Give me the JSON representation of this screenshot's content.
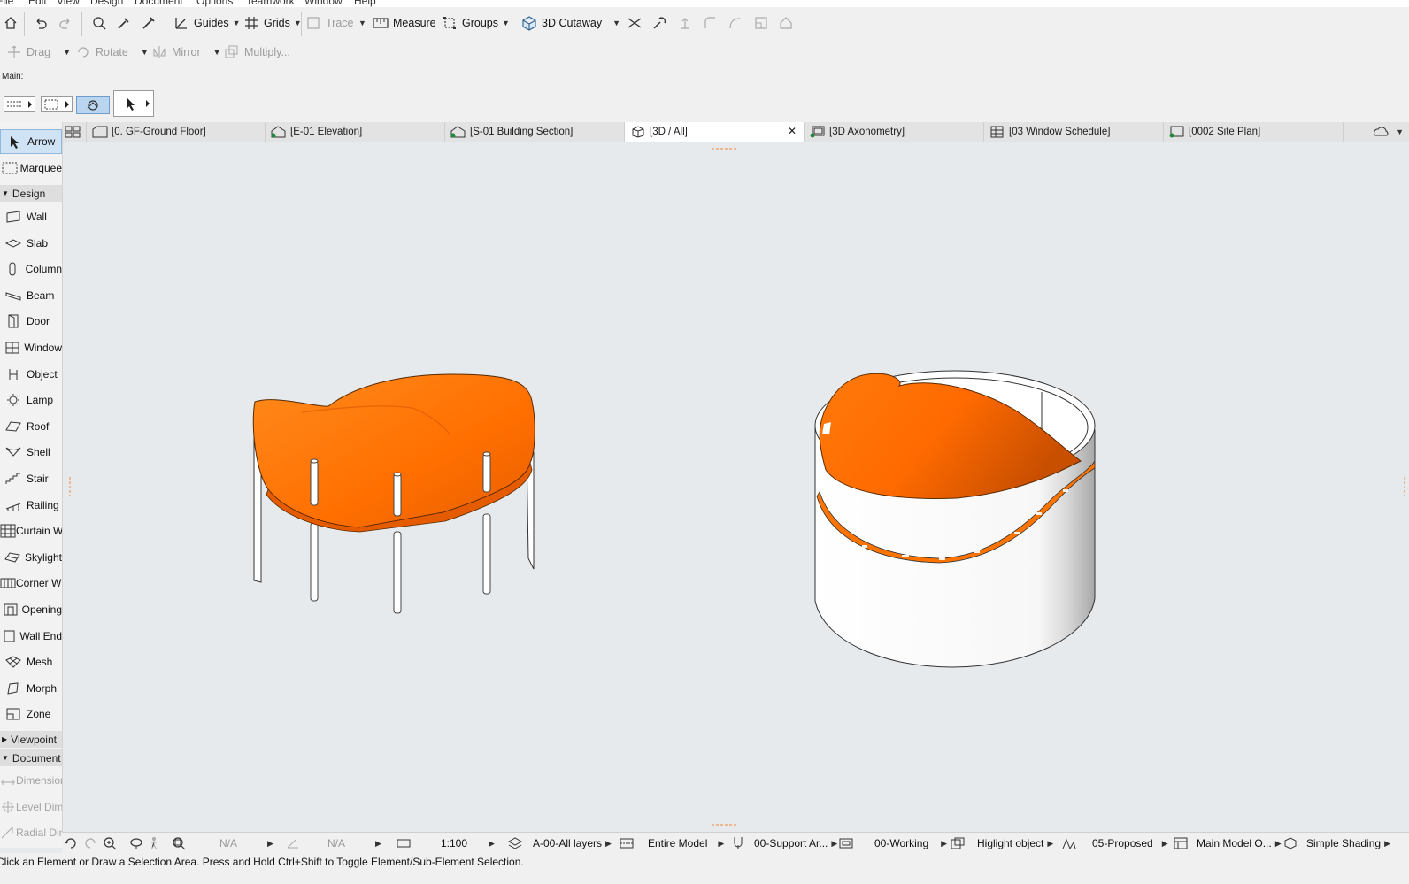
{
  "menu": [
    "File",
    "Edit",
    "View",
    "Design",
    "Document",
    "Options",
    "Teamwork",
    "Window",
    "Help"
  ],
  "toolbar1": {
    "guides": "Guides",
    "grids": "Grids",
    "trace": "Trace",
    "measure": "Measure",
    "groups": "Groups",
    "cutaway": "3D Cutaway"
  },
  "toolbar2": {
    "drag": "Drag",
    "rotate": "Rotate",
    "mirror": "Mirror",
    "multiply": "Multiply..."
  },
  "main_label": "Main:",
  "tabs": [
    {
      "label": "[0. GF-Ground Floor]"
    },
    {
      "label": "[E-01 Elevation]"
    },
    {
      "label": "[S-01 Building Section]"
    },
    {
      "label": "[3D / All]"
    },
    {
      "label": "[3D Axonometry]"
    },
    {
      "label": "[03 Window Schedule]"
    },
    {
      "label": "[0002 Site Plan]"
    }
  ],
  "toolbox": {
    "top_tools": [
      {
        "label": "Arrow",
        "icon": "arrow-icon"
      },
      {
        "label": "Marquee",
        "icon": "marquee-icon"
      }
    ],
    "design_group": "Design",
    "design_tools": [
      {
        "label": "Wall",
        "icon": "wall-icon"
      },
      {
        "label": "Slab",
        "icon": "slab-icon"
      },
      {
        "label": "Column",
        "icon": "column-icon"
      },
      {
        "label": "Beam",
        "icon": "beam-icon"
      },
      {
        "label": "Door",
        "icon": "door-icon"
      },
      {
        "label": "Window",
        "icon": "window-icon"
      },
      {
        "label": "Object",
        "icon": "object-icon"
      },
      {
        "label": "Lamp",
        "icon": "lamp-icon"
      },
      {
        "label": "Roof",
        "icon": "roof-icon"
      },
      {
        "label": "Shell",
        "icon": "shell-icon"
      },
      {
        "label": "Stair",
        "icon": "stair-icon"
      },
      {
        "label": "Railing",
        "icon": "railing-icon"
      },
      {
        "label": "Curtain Wall",
        "icon": "curtain-wall-icon"
      },
      {
        "label": "Skylight",
        "icon": "skylight-icon"
      },
      {
        "label": "Corner Window",
        "icon": "corner-window-icon"
      },
      {
        "label": "Opening",
        "icon": "opening-icon"
      },
      {
        "label": "Wall End",
        "icon": "wall-end-icon"
      },
      {
        "label": "Mesh",
        "icon": "mesh-icon"
      },
      {
        "label": "Morph",
        "icon": "morph-icon"
      },
      {
        "label": "Zone",
        "icon": "zone-icon"
      }
    ],
    "viewpoint_group": "Viewpoint",
    "document_group": "Document",
    "document_tools": [
      {
        "label": "Dimension",
        "icon": "dimension-icon"
      },
      {
        "label": "Level Dimension",
        "icon": "level-dimension-icon"
      },
      {
        "label": "Radial Dimension",
        "icon": "radial-dimension-icon"
      }
    ]
  },
  "navbar": {
    "na1": "N/A",
    "na2": "N/A",
    "scale": "1:100",
    "layers": "A-00-All layers",
    "model": "Entire Model",
    "pen": "00-Support Ar...",
    "mvo": "00-Working",
    "highlight": "Higlight object",
    "renovation": "05-Proposed",
    "structure": "Main Model O...",
    "shading": "Simple Shading"
  },
  "status_text": "Click an Element or Draw a Selection Area. Press and Hold Ctrl+Shift to Toggle Element/Sub-Element Selection.",
  "colors": {
    "accent_orange": "#ff7a0f",
    "selection_blue": "#cfe3f5",
    "canvas_bg": "#e6eaed"
  }
}
